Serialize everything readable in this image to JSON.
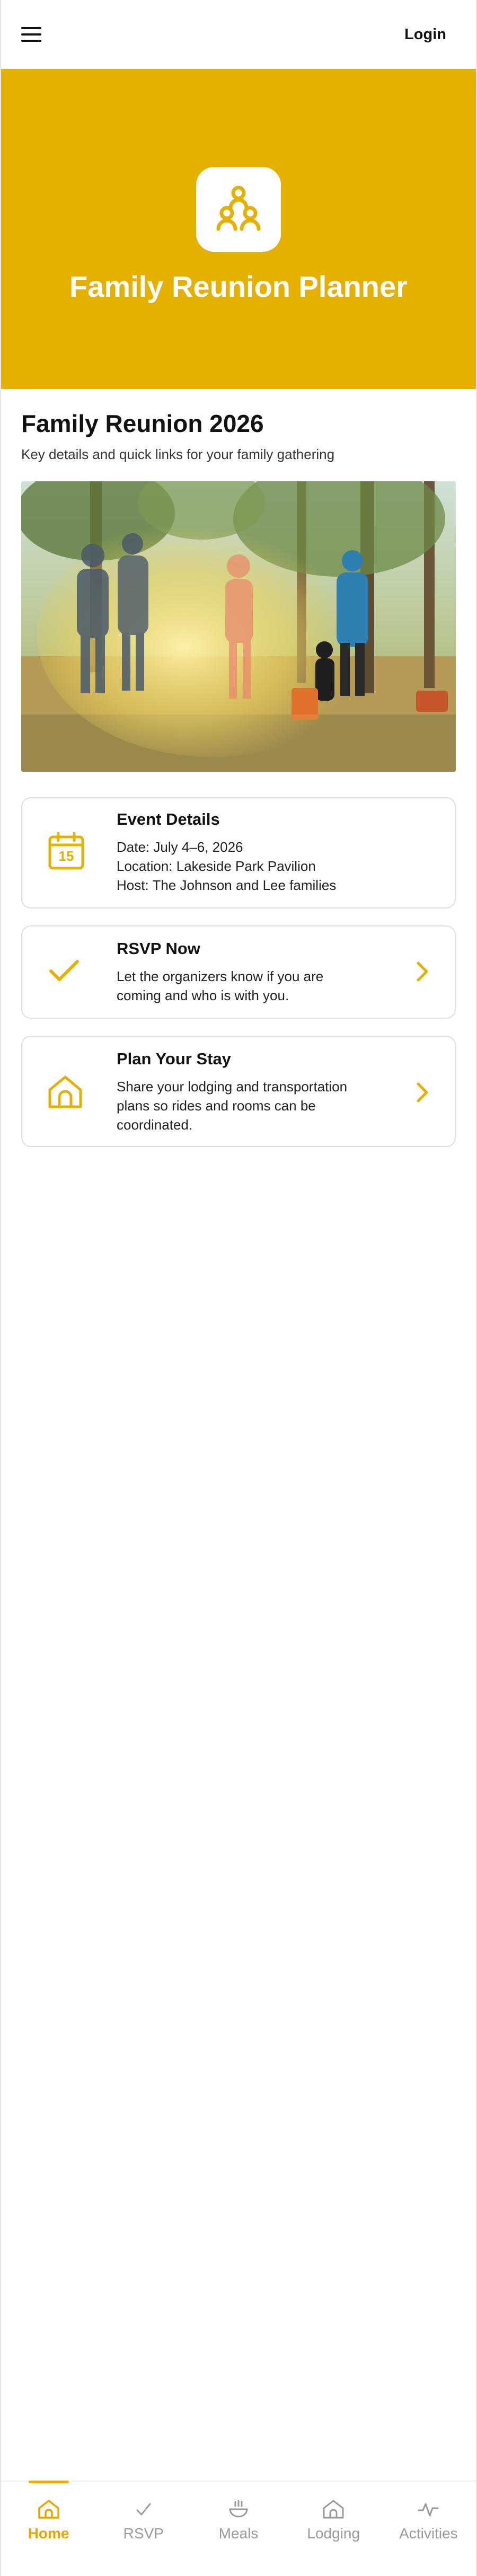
{
  "topbar": {
    "login_label": "Login"
  },
  "hero": {
    "title": "Family Reunion Planner"
  },
  "intro": {
    "title": "Family Reunion 2026",
    "subtitle": "Key details and quick links for your family gathering"
  },
  "cards": {
    "event": {
      "title": "Event Details",
      "calendar_day": "15",
      "lines": [
        "Date: July 4–6, 2026",
        "Location: Lakeside Park Pavilion",
        "Host: The Johnson and Lee families"
      ]
    },
    "rsvp": {
      "title": "RSVP Now",
      "lines": [
        "Let the organizers know if you are",
        "coming and who is with you."
      ]
    },
    "stay": {
      "title": "Plan Your Stay",
      "lines": [
        "Share your lodging and transportation",
        "plans so rides and rooms can be",
        "coordinated."
      ]
    }
  },
  "nav": {
    "items": [
      {
        "label": "Home",
        "icon": "home-icon",
        "active": true
      },
      {
        "label": "RSVP",
        "icon": "check-icon",
        "active": false
      },
      {
        "label": "Meals",
        "icon": "bowl-icon",
        "active": false
      },
      {
        "label": "Lodging",
        "icon": "house-icon",
        "active": false
      },
      {
        "label": "Activities",
        "icon": "activity-icon",
        "active": false
      }
    ]
  },
  "colors": {
    "accent": "#e5b000",
    "hero_bg": "#e5b000",
    "text": "#111111",
    "muted": "#9a9a9a"
  }
}
